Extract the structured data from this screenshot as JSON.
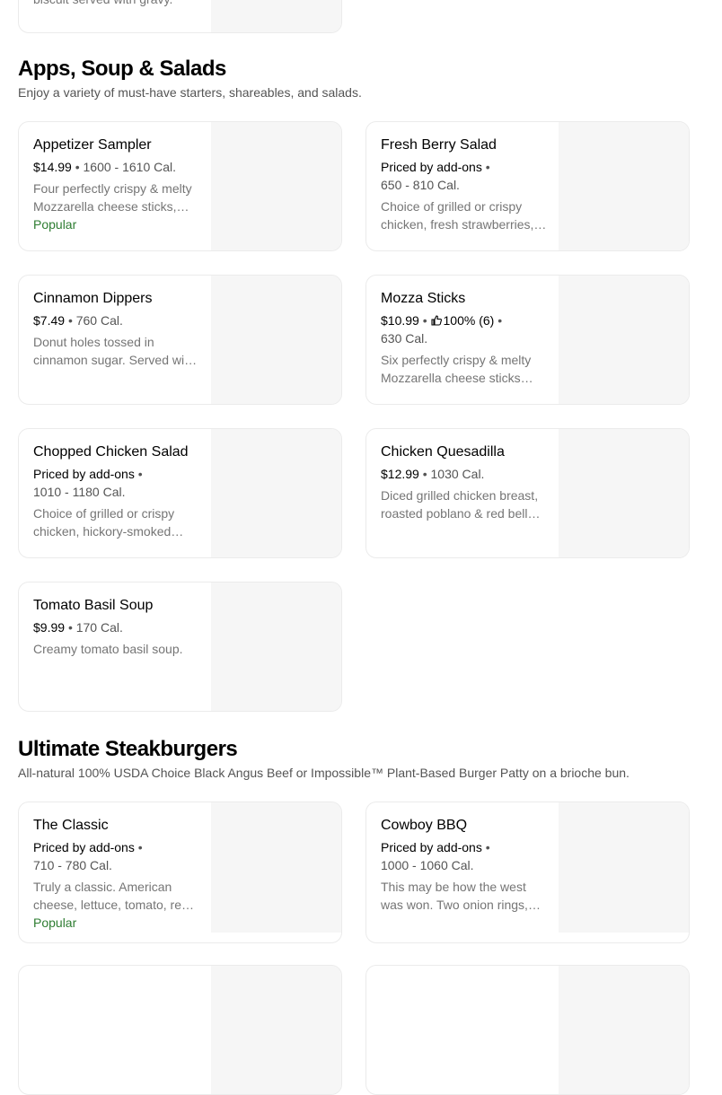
{
  "top_partial": {
    "desc": "biscuit served with gravy."
  },
  "sections": [
    {
      "title": "Apps, Soup & Salads",
      "subtitle": "Enjoy a variety of must-have starters, shareables, and salads.",
      "items": [
        {
          "name": "Appetizer Sampler",
          "price": "$14.99",
          "cal": "1600 - 1610 Cal.",
          "desc": "Four perfectly crispy & melty Mozzarella cheese sticks, onion rings, and more.",
          "badge": "Popular"
        },
        {
          "name": "Fresh Berry Salad",
          "price": "Priced by add-ons",
          "cal": "650 - 810 Cal.",
          "desc": "Choice of grilled or crispy chicken, fresh strawberries, blueberries."
        },
        {
          "name": "Cinnamon Dippers",
          "price": "$7.49",
          "cal": "760 Cal.",
          "desc": "Donut holes tossed in cinnamon sugar. Served with icing."
        },
        {
          "name": "Mozza Sticks",
          "price": "$10.99",
          "rating": "100% (6)",
          "cal": "630 Cal.",
          "desc": "Six perfectly crispy & melty Mozzarella cheese sticks served with marinara."
        },
        {
          "name": "Chopped Chicken Salad",
          "price": "Priced by add-ons",
          "cal": "1010 - 1180 Cal.",
          "desc": "Choice of grilled or crispy chicken, hickory-smoked bacon."
        },
        {
          "name": "Chicken Quesadilla",
          "price": "$12.99",
          "cal": "1030 Cal.",
          "desc": "Diced grilled chicken breast, roasted poblano & red bell peppers."
        },
        {
          "name": "Tomato Basil Soup",
          "price": "$9.99",
          "cal": "170 Cal.",
          "desc": "Creamy tomato basil soup."
        }
      ]
    },
    {
      "title": "Ultimate Steakburgers",
      "subtitle": "All-natural 100% USDA Choice Black Angus Beef or Impossible™ Plant-Based Burger Patty on a brioche bun.",
      "items": [
        {
          "name": "The Classic",
          "price": "Priced by add-ons",
          "cal": "710 - 780 Cal.",
          "desc": "Truly a classic. American cheese, lettuce, tomato, red onion.",
          "badge": "Popular"
        },
        {
          "name": "Cowboy BBQ",
          "price": "Priced by add-ons",
          "cal": "1000 - 1060 Cal.",
          "desc": "This may be how the west was won. Two onion rings, BBQ sauce."
        }
      ]
    }
  ],
  "colors": {
    "popular": "#2e7d32",
    "card_image_placeholder": "#f6f6f6"
  }
}
